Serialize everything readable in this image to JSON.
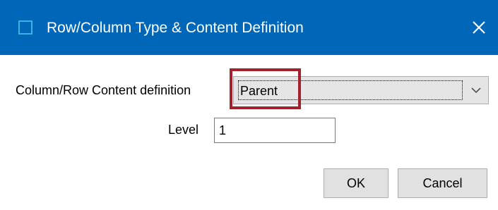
{
  "window": {
    "title": "Row/Column Type & Content Definition",
    "app_icon": "window-icon",
    "close_icon": "close-icon",
    "titlebar_color": "#0067b8"
  },
  "form": {
    "content_label": "Column/Row Content definition",
    "content_value": "Parent",
    "dropdown_icon": "chevron-down-icon",
    "level_label": "Level",
    "level_value": "1"
  },
  "annotation": {
    "highlight_color": "#a3212d"
  },
  "buttons": {
    "ok_label": "OK",
    "cancel_label": "Cancel"
  }
}
